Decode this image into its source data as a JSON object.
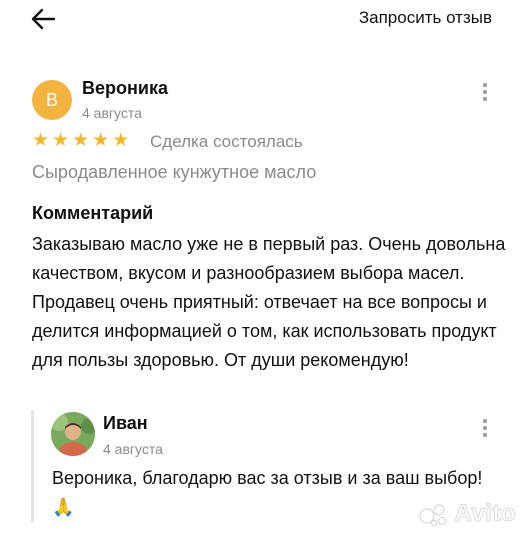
{
  "header": {
    "request_review_label": "Запросить отзыв"
  },
  "review": {
    "avatar_letter": "В",
    "author": "Вероника",
    "date": "4 августа",
    "rating": 5,
    "status": "Сделка состоялась",
    "product": "Сыродавленное кунжутное масло",
    "comment_heading": "Комментарий",
    "comment_text": "Заказываю масло уже не в первый раз. Очень довольна качеством, вкусом и разнообразием выбора масел. Продавец очень приятный: отвечает на все вопросы и делится информацией о том, как использовать продукт для пользы здоровью. От души рекомендую!"
  },
  "reply": {
    "author": "Иван",
    "date": "4 августа",
    "text": "Вероника, благодарю вас за отзыв и за ваш выбор! 🙏"
  },
  "watermark": {
    "text": "Avito"
  },
  "colors": {
    "avatar_bg": "#f2b43f",
    "star": "#f5b72e",
    "muted": "#8a8a8a"
  }
}
